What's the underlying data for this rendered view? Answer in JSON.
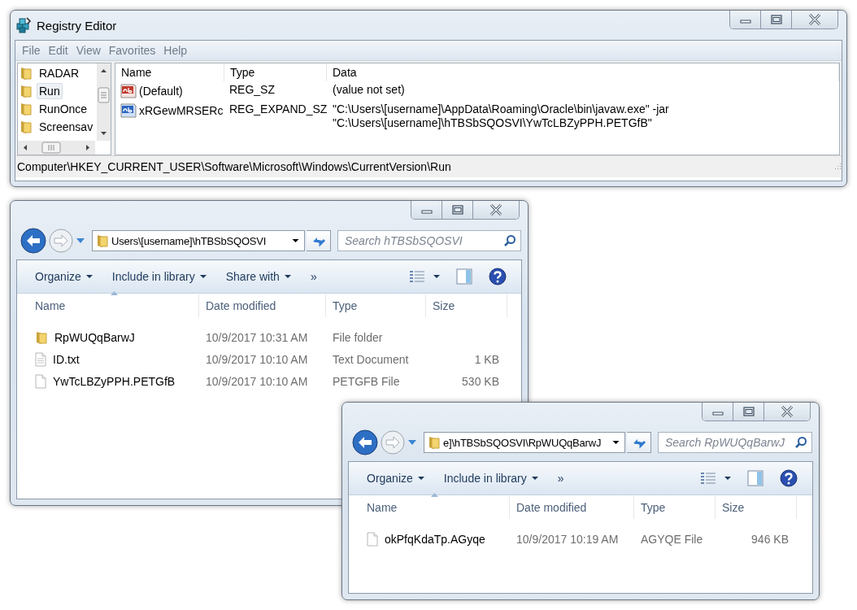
{
  "registry_editor": {
    "title": "Registry Editor",
    "menu": [
      "File",
      "Edit",
      "View",
      "Favorites",
      "Help"
    ],
    "tree": [
      {
        "label": "RADAR",
        "selected": false
      },
      {
        "label": "Run",
        "selected": true
      },
      {
        "label": "RunOnce",
        "selected": false
      },
      {
        "label": "Screensav",
        "selected": false
      }
    ],
    "columns": [
      "Name",
      "Type",
      "Data"
    ],
    "values": [
      {
        "kind": "sz",
        "name": "(Default)",
        "type": "REG_SZ",
        "data": "(value not set)"
      },
      {
        "kind": "expand_sz",
        "name": "xRGewMRSERc",
        "type": "REG_EXPAND_SZ",
        "data": "\"C:\\Users\\[username]\\AppData\\Roaming\\Oracle\\bin\\javaw.exe\" -jar \"C:\\Users\\[username]\\hTBSbSQOSVI\\YwTcLBZyPPH.PETGfB\""
      }
    ],
    "status_bar": "Computer\\HKEY_CURRENT_USER\\Software\\Microsoft\\Windows\\CurrentVersion\\Run"
  },
  "explorer_windows": [
    {
      "back_enabled": true,
      "forward_enabled": false,
      "address": "Users\\[username]\\hTBSbSQOSVI",
      "search_placeholder": "Search hTBSbSQOSVI",
      "toolbar": [
        "Organize",
        "Include in library",
        "Share with"
      ],
      "overflow": "»",
      "columns": [
        "Name",
        "Date modified",
        "Type",
        "Size"
      ],
      "files": [
        {
          "kind": "folder",
          "name": "RpWUQqBarwJ",
          "date": "10/9/2017 10:31 AM",
          "type": "File folder"
        },
        {
          "kind": "text",
          "name": "ID.txt",
          "date": "10/9/2017 10:10 AM",
          "type": "Text Document",
          "size": "1 KB"
        },
        {
          "kind": "file",
          "name": "YwTcLBZyPPH.PETGfB",
          "date": "10/9/2017 10:10 AM",
          "type": "PETGFB File",
          "size": "530 KB"
        }
      ]
    },
    {
      "back_enabled": true,
      "forward_enabled": false,
      "address": "e]\\hTBSbSQOSVI\\RpWUQqBarwJ",
      "search_placeholder": "Search RpWUQqBarwJ",
      "toolbar": [
        "Organize",
        "Include in library"
      ],
      "overflow": "»",
      "columns": [
        "Name",
        "Date modified",
        "Type",
        "Size"
      ],
      "files": [
        {
          "kind": "file",
          "name": "okPfqKdaTp.AGyqe",
          "date": "10/9/2017 10:19 AM",
          "type": "AGYQE File",
          "size": "946 KB"
        }
      ]
    }
  ]
}
